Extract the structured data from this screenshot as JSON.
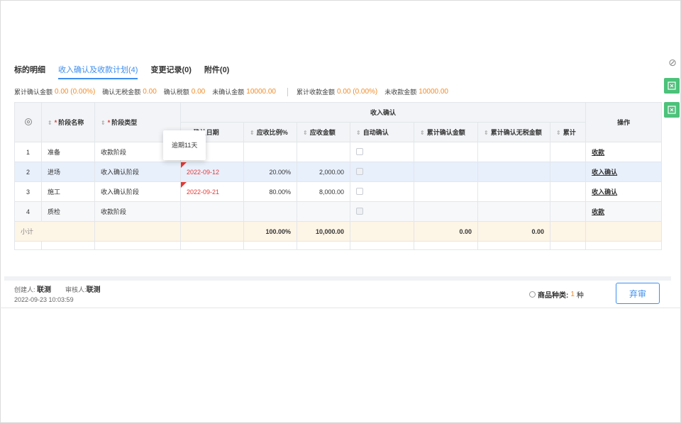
{
  "tabs": [
    {
      "label": "标的明细"
    },
    {
      "label": "收入确认及收款计划(4)"
    },
    {
      "label": "变更记录(0)"
    },
    {
      "label": "附件(0)"
    }
  ],
  "summary": {
    "confirmed_label": "累计确认金额",
    "confirmed_value": "0.00 (0.00%)",
    "confirmed_notax_label": "确认无税金额",
    "confirmed_notax_value": "0.00",
    "confirmed_tax_label": "确认税额",
    "confirmed_tax_value": "0.00",
    "unconfirmed_label": "未确认金额",
    "unconfirmed_value": "10000.00",
    "collected_label": "累计收款金额",
    "collected_value": "0.00 (0.00%)",
    "uncollected_label": "未收款金额",
    "uncollected_value": "10000.00"
  },
  "table": {
    "group_header": "收入确认",
    "headers": {
      "stage_name": "阶段名称",
      "stage_type": "阶段类型",
      "confirm_date": "确认日期",
      "ratio": "应收比例%",
      "amount": "应收金额",
      "auto_confirm": "自动确认",
      "cum_confirmed": "累计确认金额",
      "cum_notax": "累计确认无税金额",
      "cum_cut": "累计",
      "ops": "操作"
    },
    "rows": [
      {
        "idx": "1",
        "name": "准备",
        "type": "收款阶段",
        "date": "",
        "ratio": "",
        "amount": "",
        "cum": "",
        "cum_notax": "",
        "op": "收款"
      },
      {
        "idx": "2",
        "name": "进场",
        "type": "收入确认阶段",
        "date": "2022-09-12",
        "ratio": "20.00%",
        "amount": "2,000.00",
        "cum": "",
        "cum_notax": "",
        "op": "收入确认"
      },
      {
        "idx": "3",
        "name": "施工",
        "type": "收入确认阶段",
        "date": "2022-09-21",
        "ratio": "80.00%",
        "amount": "8,000.00",
        "cum": "",
        "cum_notax": "",
        "op": "收入确认"
      },
      {
        "idx": "4",
        "name": "质检",
        "type": "收款阶段",
        "date": "",
        "ratio": "",
        "amount": "",
        "cum": "",
        "cum_notax": "",
        "op": "收款"
      }
    ],
    "subtotal": {
      "label": "小计",
      "ratio": "100.00%",
      "amount": "10,000.00",
      "cum": "0.00",
      "cum_notax": "0.00"
    }
  },
  "tooltip": "逾期11天",
  "footer": {
    "creator_label": "创建人:",
    "creator_name": "联测",
    "reviewer_label": "审核人:",
    "reviewer_name": "联测",
    "created_time": "2022-09-23 10:03:59",
    "goods_label": "商品种类:",
    "goods_count": "1",
    "goods_unit": "种",
    "discard_label": "弃审"
  },
  "colors": {
    "accent": "#3d8ef0",
    "warning": "#f08c2a",
    "overdue": "#e53935",
    "rail": "#4cc27a"
  }
}
